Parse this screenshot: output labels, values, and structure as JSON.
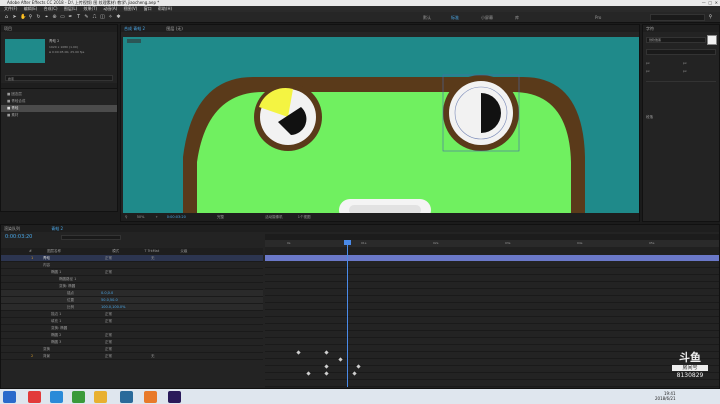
{
  "window": {
    "title": "Adobe After Effects CC 2018 - D:\\ 上传视频\\ 图 纹理素材\\ 教学\\ jiaocheng.aep *"
  },
  "menu": [
    "文件(F)",
    "编辑(E)",
    "合成(C)",
    "图层(L)",
    "效果(T)",
    "动画(A)",
    "视图(V)",
    "窗口",
    "帮助(H)"
  ],
  "workspaces": [
    "默认",
    "标准",
    "小屏幕",
    "库",
    "Pro"
  ],
  "project": {
    "tab": "项目",
    "item_name": "青蛙 2",
    "item_meta": "1920 x 1080 (1.00)",
    "item_meta2": "Δ 0:00:05:00, 25.00 fps",
    "search_placeholder": "搜索",
    "files": [
      "■ 固态层",
      "■ 青蛙合成",
      "■ 青蛙",
      "■ 素材"
    ]
  },
  "viewer": {
    "tabs": [
      "合成 青蛙 2",
      "图层 (无)"
    ],
    "zoom": "50%",
    "timecode": "0:00:03:20",
    "resolution": "完整",
    "camera": "活动摄像机",
    "views": "1个视图"
  },
  "right_panel": {
    "title": "字符",
    "font": "微软雅黑",
    "labels": [
      "px",
      "px",
      "px",
      "px"
    ],
    "tabs": [
      "段落"
    ]
  },
  "timeline": {
    "tabs": [
      "渲染队列",
      "青蛙 2"
    ],
    "timecode": "0:00:03:20",
    "columns": [
      "#",
      "图层名称",
      "模式",
      "T TrkMat",
      "父级"
    ],
    "layers": [
      {
        "num": "1",
        "name": "青蛙",
        "mode": "正常",
        "parent": "无"
      },
      {
        "num": "",
        "name": "内容",
        "mode": "",
        "parent": ""
      },
      {
        "num": "",
        "name": "椭圆 1",
        "mode": "正常",
        "parent": ""
      },
      {
        "num": "",
        "name": "椭圆路径 1",
        "mode": "",
        "parent": ""
      },
      {
        "num": "",
        "name": "变换: 椭圆",
        "mode": "",
        "parent": ""
      },
      {
        "num": "",
        "name": "锚点",
        "mode": "",
        "value": "0.0,0.0",
        "parent": ""
      },
      {
        "num": "",
        "name": "位置",
        "mode": "",
        "value": "50.0,50.0",
        "parent": ""
      },
      {
        "num": "",
        "name": "比例",
        "mode": "",
        "value": "100.0,100.0%",
        "parent": ""
      },
      {
        "num": "",
        "name": "描边 1",
        "mode": "正常",
        "parent": ""
      },
      {
        "num": "",
        "name": "填充 1",
        "mode": "正常",
        "parent": ""
      },
      {
        "num": "",
        "name": "变换: 椭圆",
        "mode": "",
        "parent": ""
      },
      {
        "num": "",
        "name": "椭圆 2",
        "mode": "正常",
        "parent": ""
      },
      {
        "num": "",
        "name": "椭圆 3",
        "mode": "正常",
        "parent": ""
      },
      {
        "num": "",
        "name": "变换",
        "mode": "正常",
        "parent": ""
      },
      {
        "num": "2",
        "name": "背景",
        "mode": "正常",
        "parent": "无"
      }
    ],
    "ruler": [
      "0s",
      "01s",
      "02s",
      "03s",
      "04s",
      "05s"
    ]
  },
  "taskbar": {
    "time": "19:41",
    "date": "2018/6/21"
  },
  "watermark": {
    "brand": "斗鱼",
    "sub": "房间号",
    "room": "8130829"
  },
  "colors": {
    "teal": "#1f8a8a",
    "frog_green": "#70f060",
    "frog_brown": "#5a3a1a",
    "accent_blue": "#4aa8e8"
  }
}
